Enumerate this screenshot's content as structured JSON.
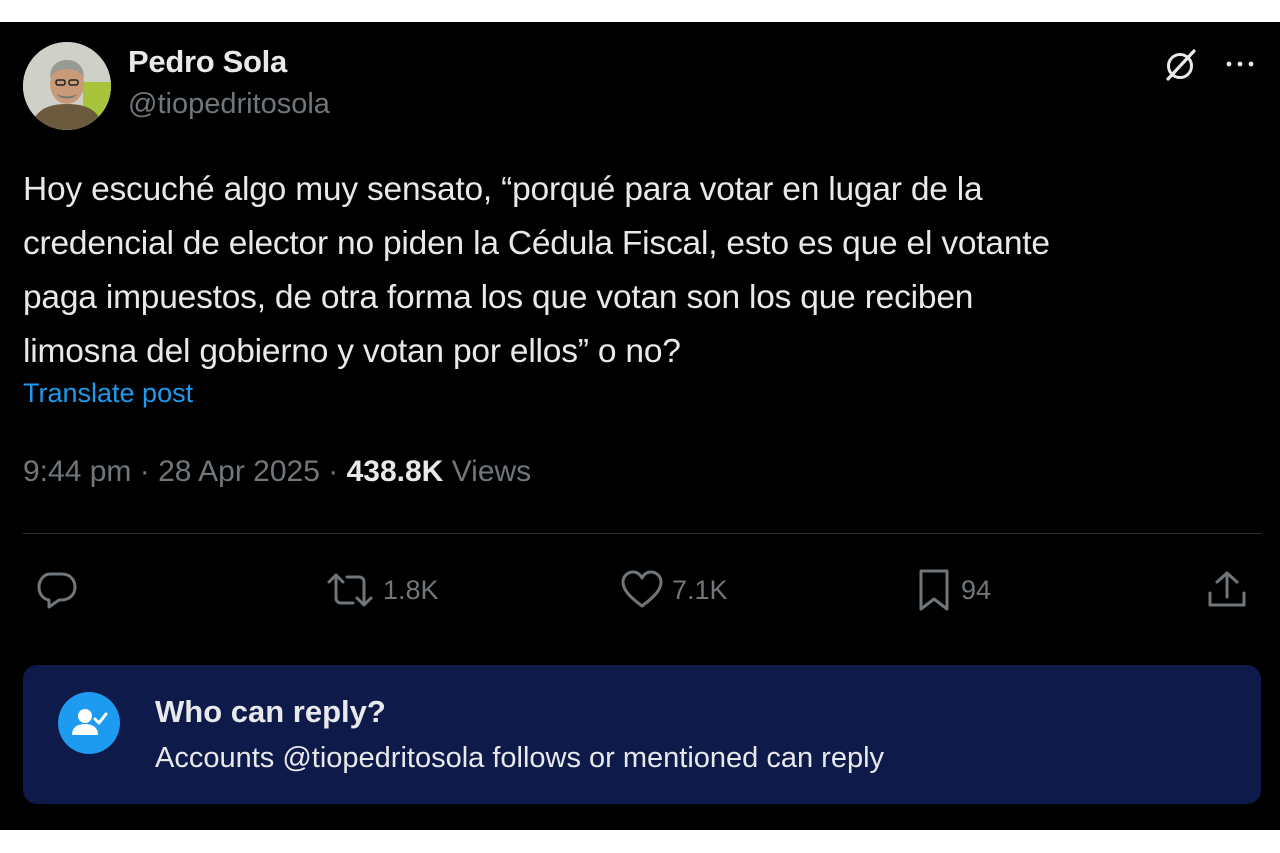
{
  "author": {
    "display_name": "Pedro Sola",
    "handle": "@tiopedritosola"
  },
  "tweet": {
    "text": "Hoy escuché algo muy sensato, “porqué para votar en lugar de la\ncredencial de elector no piden la Cédula Fiscal, esto es que el votante\npaga impuestos, de otra forma los que votan son los que reciben\nlimosna del gobierno y votan por ellos” o no?",
    "translate_label": "Translate post",
    "time": "9:44 pm",
    "separator": "·",
    "date": "28 Apr 2025",
    "views_count": "438.8K",
    "views_label": "Views"
  },
  "actions": {
    "reply_icon": "speech-bubble-icon",
    "retweet_icon": "retweet-icon",
    "retweets": "1.8K",
    "like_icon": "heart-icon",
    "likes": "7.1K",
    "bookmark_icon": "bookmark-icon",
    "bookmarks": "94",
    "share_icon": "share-upload-icon"
  },
  "reply_restriction": {
    "icon": "person-check-icon",
    "title": "Who can reply?",
    "description": "Accounts @tiopedritosola follows or mentioned can reply"
  },
  "header_icons": {
    "grok": "grok-icon",
    "more": "more-dots-icon"
  },
  "colors": {
    "background": "#000000",
    "primary_text": "#e7e9ea",
    "secondary_text": "#71767b",
    "link": "#1d9bf0",
    "reply_box": "#0e1a4a"
  }
}
